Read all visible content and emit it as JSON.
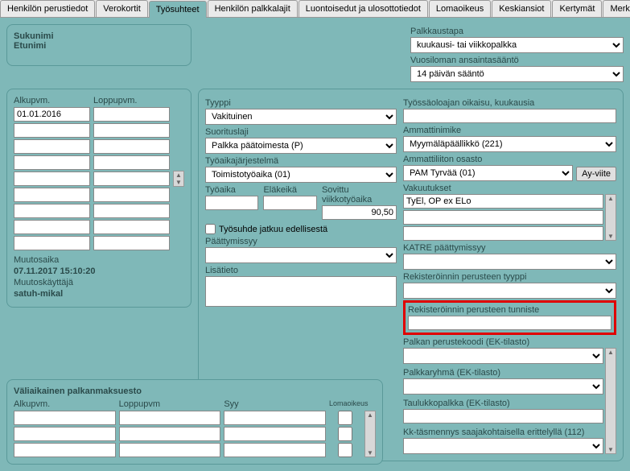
{
  "tabs": [
    {
      "label": "Henkilön perustiedot"
    },
    {
      "label": "Verokortit"
    },
    {
      "label": "Työsuhteet"
    },
    {
      "label": "Henkilön palkkalajit"
    },
    {
      "label": "Luontoisedut ja ulosottotiedot"
    },
    {
      "label": "Lomaoikeus"
    },
    {
      "label": "Keskiansiot"
    },
    {
      "label": "Kertymät"
    },
    {
      "label": "Merkkipäivät"
    }
  ],
  "active_tab": 2,
  "name_panel": {
    "sukunimi_label": "Sukunimi",
    "etunimi_label": "Etunimi"
  },
  "dates_panel": {
    "alkupvm_label": "Alkupvm.",
    "loppupvm_label": "Loppupvm.",
    "rows": [
      {
        "alku": "01.01.2016",
        "loppu": ""
      },
      {
        "alku": "",
        "loppu": ""
      },
      {
        "alku": "",
        "loppu": ""
      },
      {
        "alku": "",
        "loppu": ""
      },
      {
        "alku": "",
        "loppu": ""
      },
      {
        "alku": "",
        "loppu": ""
      },
      {
        "alku": "",
        "loppu": ""
      },
      {
        "alku": "",
        "loppu": ""
      },
      {
        "alku": "",
        "loppu": ""
      }
    ],
    "muutosaika_label": "Muutosaika",
    "muutosaika_value": "07.11.2017 15:10:20",
    "muutoskayttaja_label": "Muutoskäyttäjä",
    "muutoskayttaja_value": "satuh-mikal"
  },
  "mid": {
    "tyyppi_label": "Tyyppi",
    "tyyppi_value": "Vakituinen",
    "suorituslaji_label": "Suorituslaji",
    "suorituslaji_value": "Palkka päätoimesta (P)",
    "tyoaikajarjestelma_label": "Työaikajärjestelmä",
    "tyoaikajarjestelma_value": "Toimistotyöaika (01)",
    "tyoaika_label": "Työaika",
    "elakeika_label": "Eläkeikä",
    "sovittu_label": "Sovittu viikkotyöaika",
    "tyoaika_value": "",
    "elakeika_value": "",
    "sovittu_value": "90,50",
    "jatkuu_label": "Työsuhde jatkuu edellisestä",
    "paattymissyy_label": "Päättymissyy",
    "paattymissyy_value": "",
    "lisatieto_label": "Lisätieto",
    "lisatieto_value": ""
  },
  "right": {
    "palkkaustapa_label": "Palkkaustapa",
    "palkkaustapa_value": "kuukausi- tai viikkopalkka",
    "vuosiloma_label": "Vuosiloman ansaintasääntö",
    "vuosiloma_value": "14 päivän sääntö",
    "tyossaolo_label": "Työssäoloajan oikaisu, kuukausia",
    "tyossaolo_value": "",
    "ammattinimike_label": "Ammattinimike",
    "ammattinimike_value": "Myymäläpäällikkö (221)",
    "ammattiliitto_label": "Ammattiliiton osasto",
    "ammattiliitto_value": "PAM Tyrvää (01)",
    "ayviite_label": "Ay-viite",
    "vakuutukset_label": "Vakuutukset",
    "vakuutukset_values": [
      "TyEl, OP ex ELo",
      "",
      ""
    ],
    "katre_label": "KATRE päättymissyy",
    "katre_value": "",
    "rekperusteen_tyyppi_label": "Rekisteröinnin perusteen tyyppi",
    "rekperusteen_tyyppi_value": "",
    "rekperusteen_tunniste_label": "Rekisteröinnin perusteen tunniste",
    "rekperusteen_tunniste_value": "",
    "palkan_label": "Palkan perustekoodi (EK-tilasto)",
    "palkan_value": "",
    "palkkaryhma_label": "Palkkaryhmä (EK-tilasto)",
    "palkkaryhma_value": "",
    "taulukkopalkka_label": "Taulukkopalkka (EK-tilasto)",
    "taulukkopalkka_value": "",
    "kktasmennys_label": "Kk-täsmennys saajakohtaisella erittelyllä (112)",
    "kktasmennys_value": ""
  },
  "valiaikainen": {
    "title": "Väliaikainen palkanmaksuesto",
    "alkupvm_label": "Alkupvm.",
    "loppupvm_label": "Loppupvm",
    "syy_label": "Syy",
    "lomaoikeus_label": "Lomaoikeus",
    "rows": [
      {
        "alku": "",
        "loppu": "",
        "syy": "",
        "loma": false
      },
      {
        "alku": "",
        "loppu": "",
        "syy": "",
        "loma": false
      },
      {
        "alku": "",
        "loppu": "",
        "syy": "",
        "loma": false
      }
    ]
  }
}
